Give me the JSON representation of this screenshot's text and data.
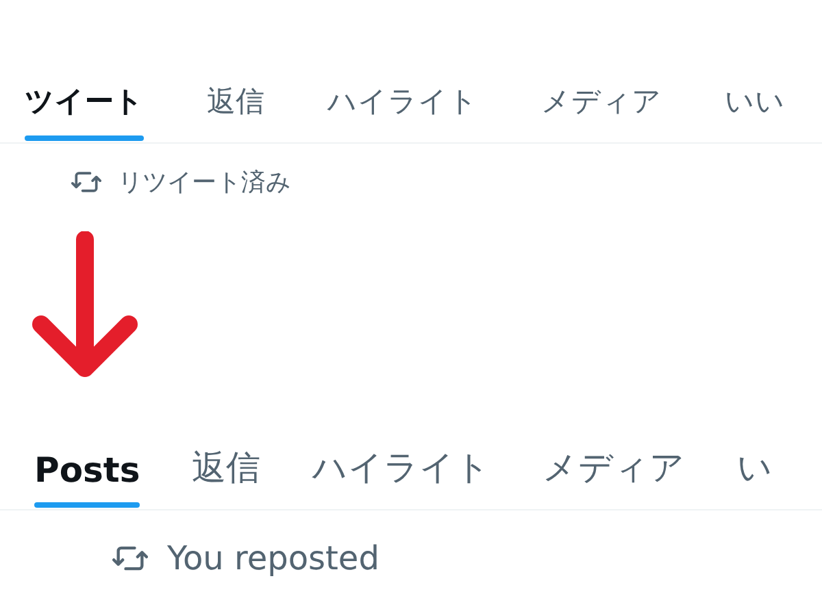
{
  "before": {
    "tabs": [
      {
        "label": "ツイート",
        "selected": true
      },
      {
        "label": "返信",
        "selected": false
      },
      {
        "label": "ハイライト",
        "selected": false
      },
      {
        "label": "メディア",
        "selected": false
      },
      {
        "label": "いい",
        "selected": false
      }
    ],
    "context": "リツイート済み"
  },
  "after": {
    "tabs": [
      {
        "label": "Posts",
        "selected": true
      },
      {
        "label": "返信",
        "selected": false
      },
      {
        "label": "ハイライト",
        "selected": false
      },
      {
        "label": "メディア",
        "selected": false
      },
      {
        "label": "い",
        "selected": false
      }
    ],
    "context": "You reposted"
  }
}
